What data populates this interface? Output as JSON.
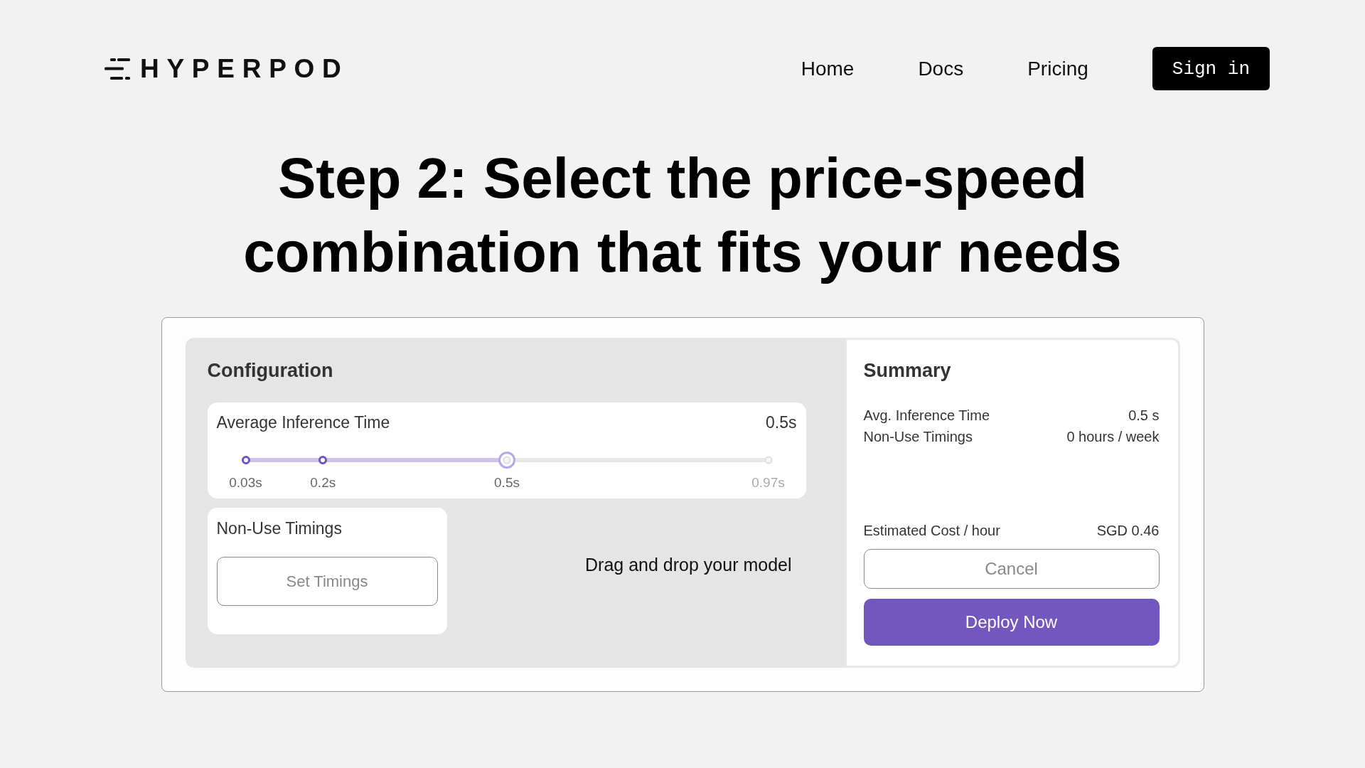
{
  "header": {
    "logo": "HYPERPOD",
    "nav": [
      {
        "label": "Home"
      },
      {
        "label": "Docs"
      },
      {
        "label": "Pricing"
      }
    ],
    "sign_in": "Sign in"
  },
  "headline": "Step 2: Select the price-speed combination that fits your needs",
  "configuration": {
    "title": "Configuration",
    "inference": {
      "label": "Average Inference Time",
      "value": "0.5s",
      "level": 0.5,
      "ticks": [
        "0.03s",
        "0.2s",
        "0.5s",
        "0.97s"
      ]
    },
    "non_use": {
      "label": "Non-Use Timings",
      "button": "Set Timings"
    },
    "drop_hint": "Drag and drop your model"
  },
  "summary": {
    "title": "Summary",
    "rows": [
      {
        "label": "Avg. Inference Time",
        "value": "0.5 s"
      },
      {
        "label": "Non-Use Timings",
        "value": "0 hours / week"
      }
    ],
    "cost": {
      "label": "Estimated Cost / hour",
      "value": "SGD 0.46"
    },
    "buttons": [
      {
        "label": "Cancel",
        "kind": "secondary"
      },
      {
        "label": "Deploy Now",
        "kind": "primary"
      }
    ]
  }
}
